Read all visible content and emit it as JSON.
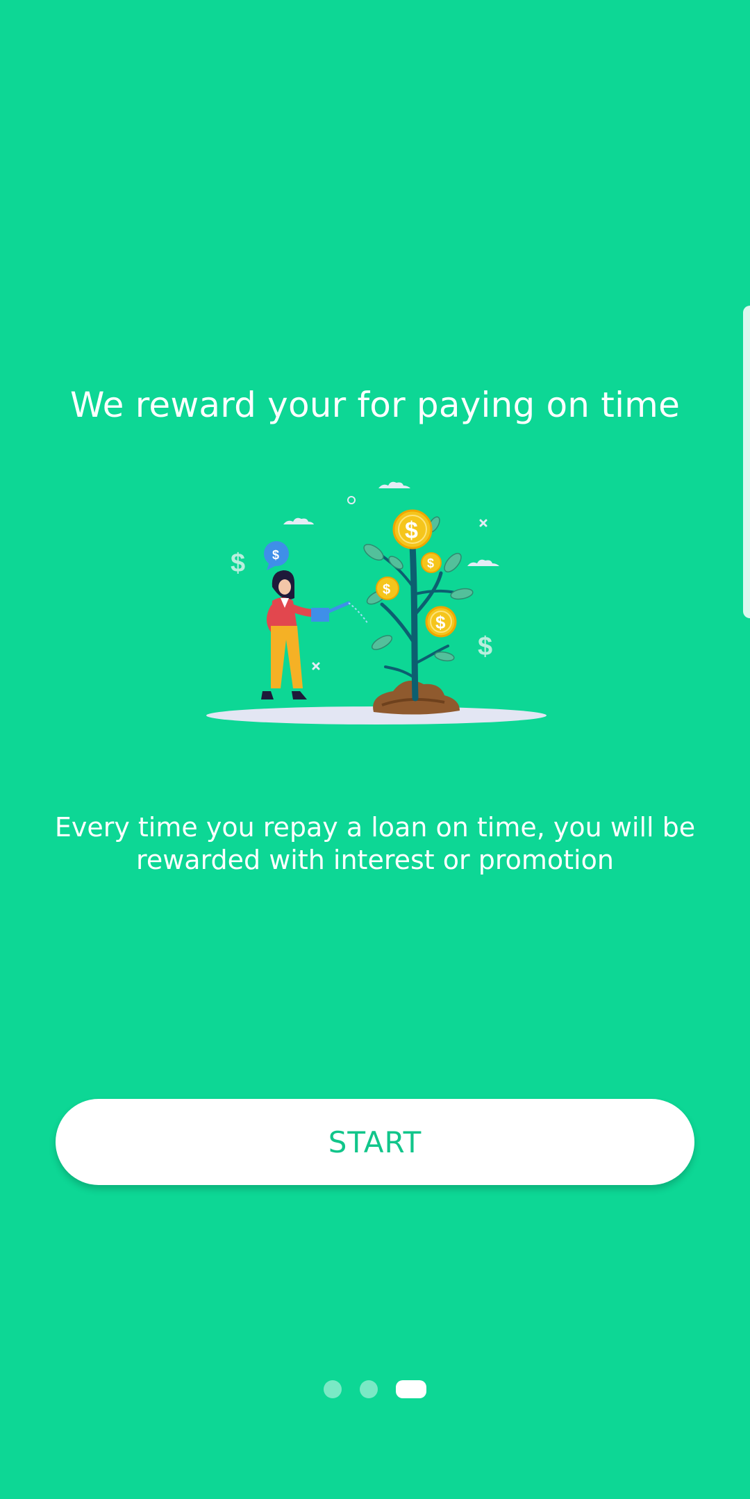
{
  "onboarding": {
    "title": "We reward your for paying on time",
    "description": "Every time you repay a loan on time, you will be rewarded with interest or promotion",
    "start_label": "START",
    "page_indicator": {
      "total": 3,
      "current": 3
    }
  },
  "illustration": {
    "coin_symbol": "$",
    "icon": "money-tree-illustration"
  },
  "colors": {
    "background": "#0dd795",
    "button_background": "#ffffff",
    "button_text": "#11c58a"
  }
}
